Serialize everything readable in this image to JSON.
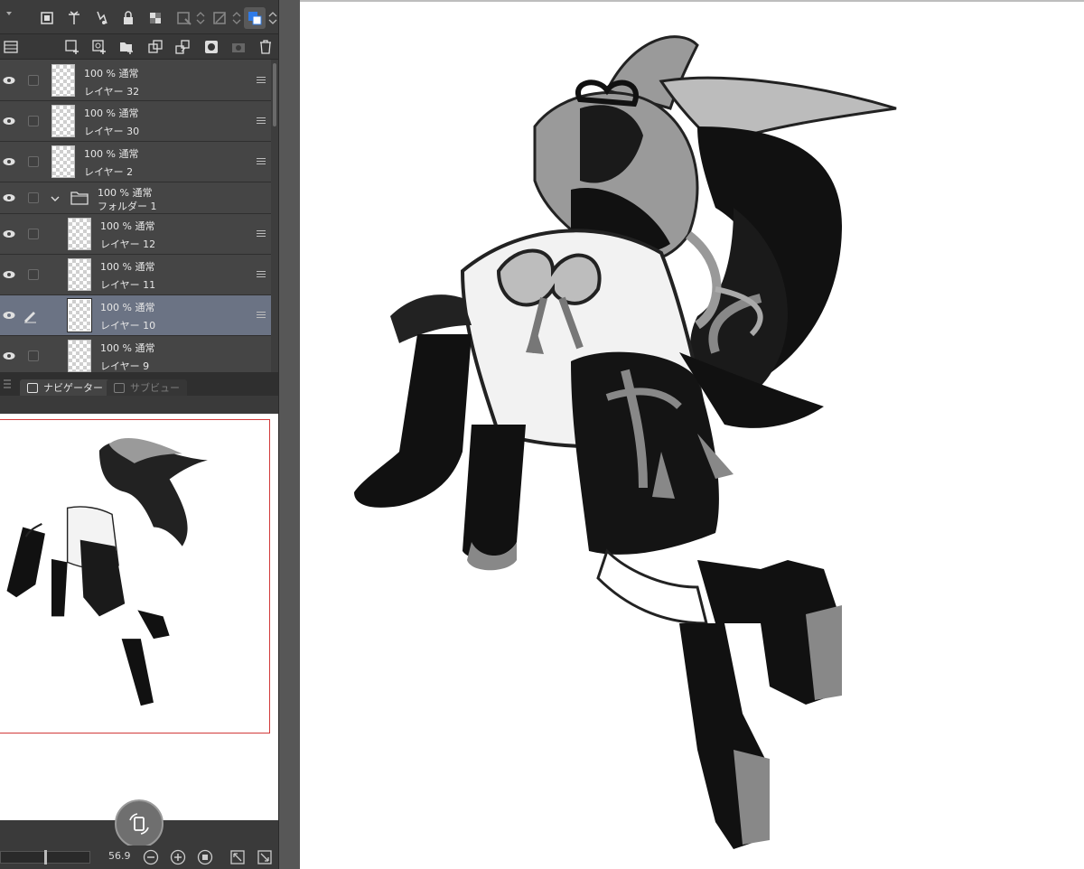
{
  "toolbar": {
    "icons": [
      "transform-icon",
      "clip-icon",
      "reference-icon",
      "lock-icon",
      "transparent-lock-icon",
      "layer-mask-icon",
      "ruler-icon",
      "color-icon"
    ]
  },
  "layer_toolbar": {
    "icons": [
      "layer-property-icon",
      "new-raster-layer-icon",
      "new-vector-layer-icon",
      "new-folder-icon",
      "copy-layer-icon",
      "merge-down-icon",
      "mask-icon",
      "camera-icon",
      "delete-layer-icon"
    ]
  },
  "layers": [
    {
      "opacity": "100 %",
      "blend": "通常",
      "name": "レイヤー 32"
    },
    {
      "opacity": "100 %",
      "blend": "通常",
      "name": "レイヤー 30"
    },
    {
      "opacity": "100 %",
      "blend": "通常",
      "name": "レイヤー 2"
    },
    {
      "opacity": "100 %",
      "blend": "通常",
      "name": "フォルダー 1"
    },
    {
      "opacity": "100 %",
      "blend": "通常",
      "name": "レイヤー 12"
    },
    {
      "opacity": "100 %",
      "blend": "通常",
      "name": "レイヤー 11"
    },
    {
      "opacity": "100 %",
      "blend": "通常",
      "name": "レイヤー 10"
    },
    {
      "opacity": "100 %",
      "blend": "通常",
      "name": "レイヤー 9"
    }
  ],
  "tabs": {
    "navigator": "ナビゲーター",
    "subview": "サブビュー"
  },
  "navigator": {
    "zoom": "56.9"
  },
  "colors": {
    "panel": "#3a3a3a",
    "selected_row": "#6b7384",
    "nav_frame": "#d23a3a"
  }
}
